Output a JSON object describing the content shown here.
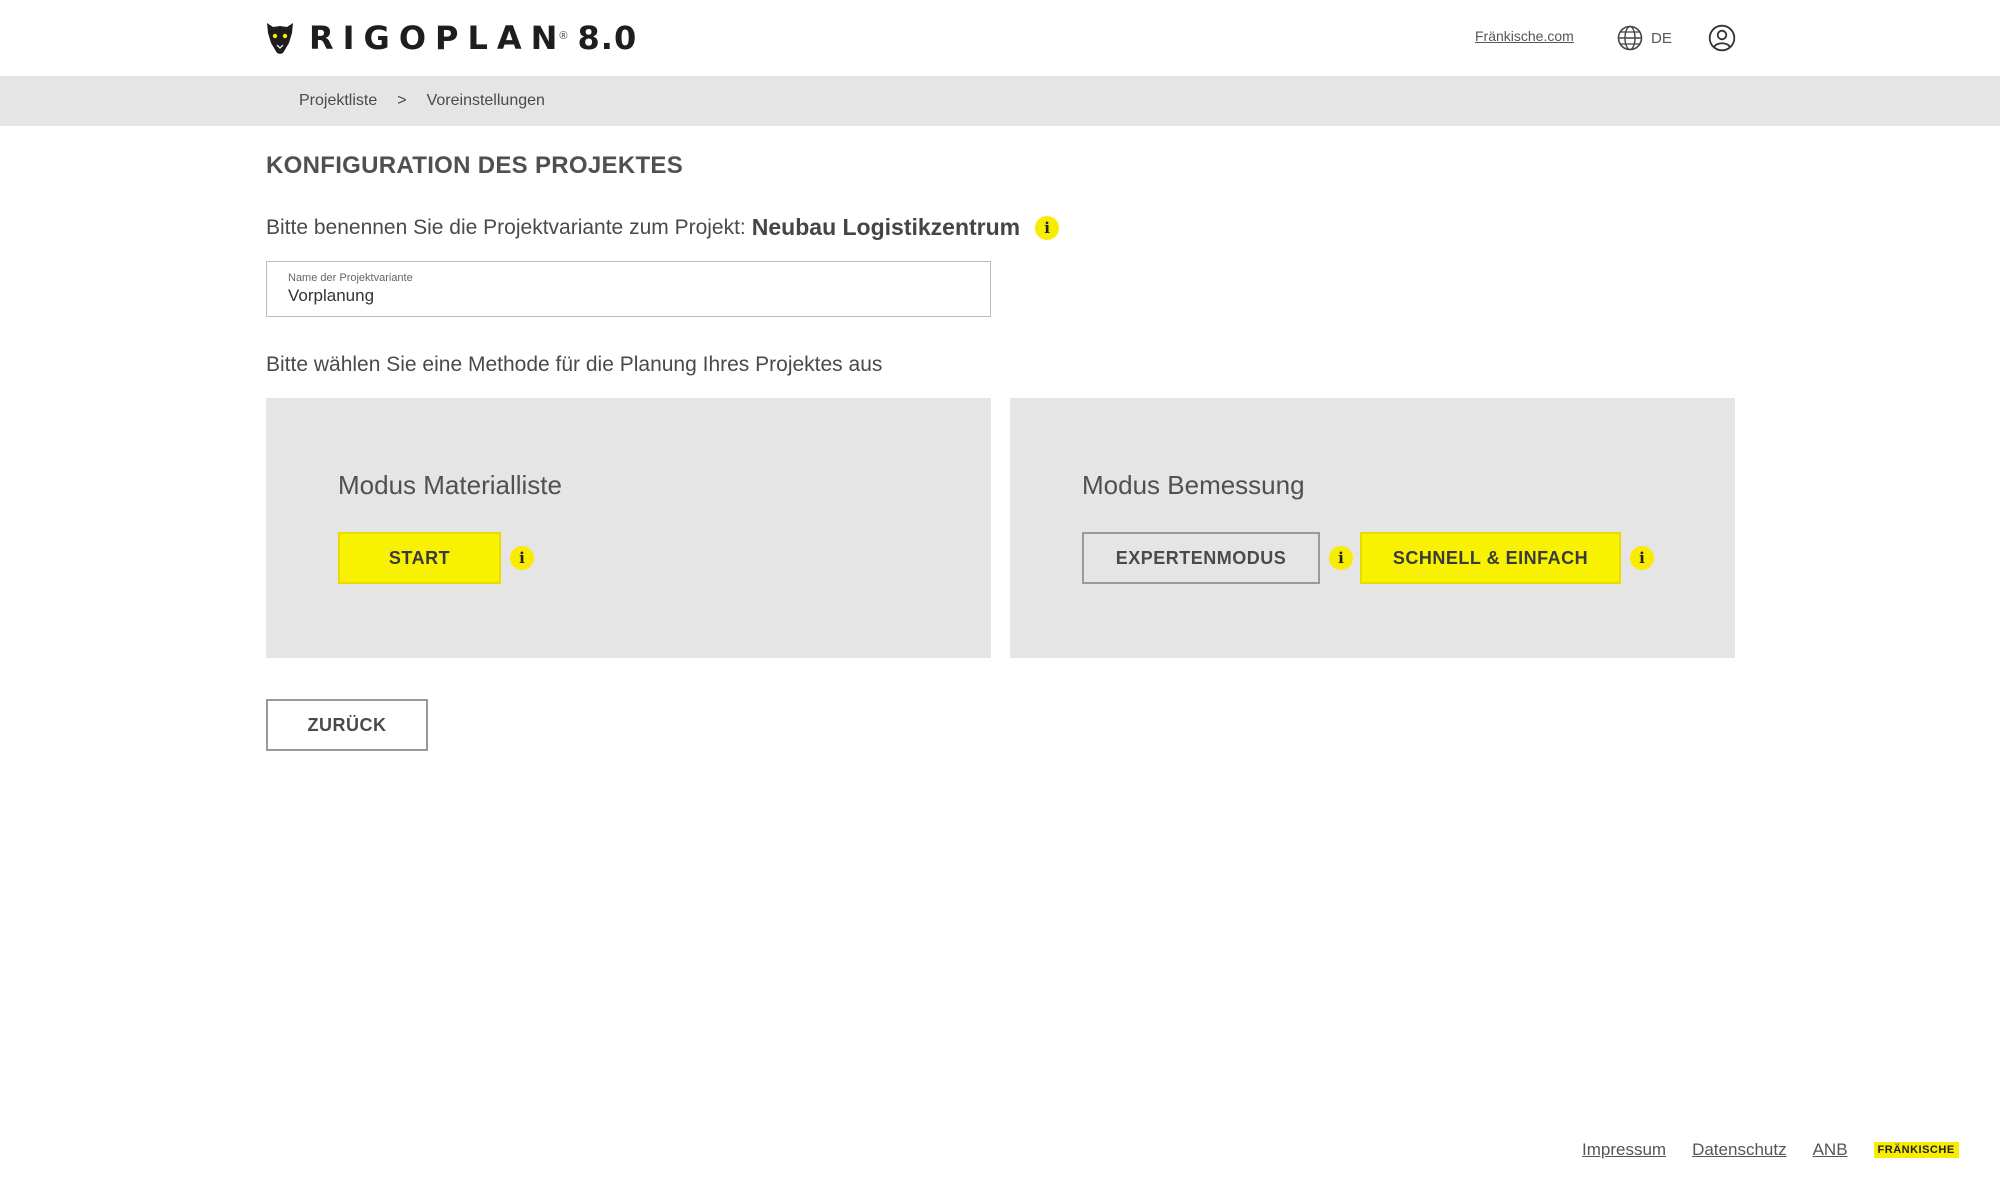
{
  "header": {
    "logo_text": "RIGOPLAN",
    "logo_reg": "®",
    "logo_version": "8.0",
    "logo_icon": "panther-icon",
    "company_link": "Fränkische.com",
    "language": "DE",
    "globe_icon": "globe-icon",
    "user_icon": "user-account-icon"
  },
  "breadcrumb": {
    "items": [
      "Projektliste",
      "Voreinstellungen"
    ],
    "separator": ">"
  },
  "main": {
    "title": "KONFIGURATION DES PROJEKTES",
    "variant_prompt": "Bitte benennen Sie die Projektvariante zum Projekt:",
    "project_name": "Neubau Logistikzentrum",
    "variant_field": {
      "label": "Name der Projektvariante",
      "value": "Vorplanung"
    },
    "method_prompt": "Bitte wählen Sie eine Methode für die Planung Ihres Projektes aus",
    "info_glyph": "i",
    "cards": {
      "materialliste": {
        "title": "Modus Materialliste",
        "start_label": "START"
      },
      "bemessung": {
        "title": "Modus Bemessung",
        "expert_label": "EXPERTENMODUS",
        "quick_label": "SCHNELL & EINFACH"
      }
    },
    "back_label": "ZURÜCK"
  },
  "footer": {
    "links": [
      "Impressum",
      "Datenschutz",
      "ANB"
    ],
    "brand": "FRÄNKISCHE"
  },
  "colors": {
    "accent_yellow": "#f8f200",
    "panel_gray": "#e5e5e5",
    "text": "#4a4a4a"
  }
}
